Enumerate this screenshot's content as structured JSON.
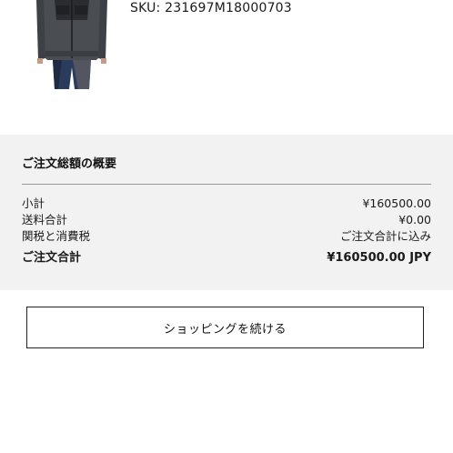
{
  "product": {
    "sku": "SKU: 231697M18000703"
  },
  "summary": {
    "title": "ご注文総額の概要",
    "rows": [
      {
        "label": "小計",
        "value": "¥160500.00"
      },
      {
        "label": "送料合計",
        "value": "¥0.00"
      },
      {
        "label": "関税と消費税",
        "value": "ご注文合計に込み"
      }
    ],
    "total": {
      "label": "ご注文合計",
      "value": "¥160500.00 JPY"
    }
  },
  "actions": {
    "continue_shopping": "ショッピングを続ける"
  }
}
